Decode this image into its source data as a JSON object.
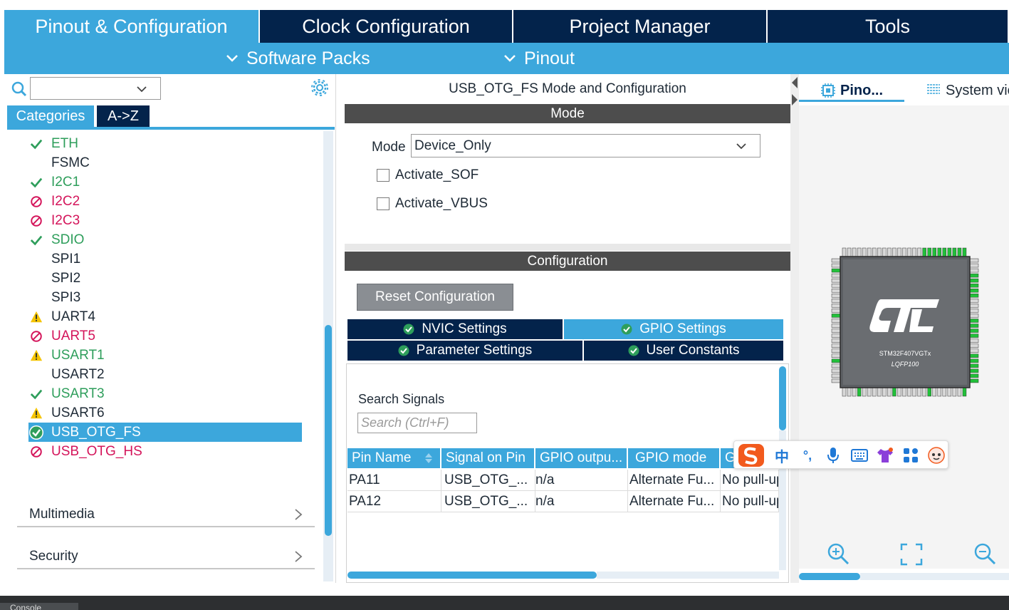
{
  "top_tabs": [
    {
      "label": "Pinout & Configuration",
      "active": true
    },
    {
      "label": "Clock Configuration",
      "active": false
    },
    {
      "label": "Project Manager",
      "active": false
    },
    {
      "label": "Tools",
      "active": false
    }
  ],
  "sub_menu": {
    "software_packs": "Software Packs",
    "pinout": "Pinout"
  },
  "left": {
    "search_value": "",
    "categories_tab": "Categories",
    "az_tab": "A->Z",
    "peripherals": [
      {
        "label": "ETH",
        "status": "ok"
      },
      {
        "label": "FSMC",
        "status": "none"
      },
      {
        "label": "I2C1",
        "status": "ok"
      },
      {
        "label": "I2C2",
        "status": "blocked"
      },
      {
        "label": "I2C3",
        "status": "blocked"
      },
      {
        "label": "SDIO",
        "status": "ok"
      },
      {
        "label": "SPI1",
        "status": "none"
      },
      {
        "label": "SPI2",
        "status": "none"
      },
      {
        "label": "SPI3",
        "status": "none"
      },
      {
        "label": "UART4",
        "status": "warn"
      },
      {
        "label": "UART5",
        "status": "blocked"
      },
      {
        "label": "USART1",
        "status": "warn"
      },
      {
        "label": "USART2",
        "status": "none"
      },
      {
        "label": "USART3",
        "status": "ok"
      },
      {
        "label": "USART6",
        "status": "warn"
      },
      {
        "label": "USB_OTG_FS",
        "status": "selected"
      },
      {
        "label": "USB_OTG_HS",
        "status": "blocked"
      }
    ],
    "groups": [
      "Multimedia",
      "Security"
    ]
  },
  "middle": {
    "title": "USB_OTG_FS Mode and Configuration",
    "mode_header": "Mode",
    "mode_label": "Mode",
    "mode_value": "Device_Only",
    "checkboxes": [
      "Activate_SOF",
      "Activate_VBUS"
    ],
    "config_header": "Configuration",
    "reset_button": "Reset Configuration",
    "tabs": {
      "nvic": "NVIC Settings",
      "gpio": "GPIO Settings",
      "parameter": "Parameter Settings",
      "user_constants": "User Constants"
    },
    "search_label": "Search Signals",
    "search_placeholder": "Search (Ctrl+F)",
    "table": {
      "headers": [
        "Pin Name",
        "Signal on Pin",
        "GPIO outpu...",
        "GPIO mode",
        "G"
      ],
      "rows": [
        [
          "PA11",
          "USB_OTG_...",
          "n/a",
          "Alternate Fu...",
          "No pull-up"
        ],
        [
          "PA12",
          "USB_OTG_...",
          "n/a",
          "Alternate Fu...",
          "No pull-up"
        ]
      ]
    }
  },
  "right": {
    "tab_pinout": "Pino...",
    "tab_system": "System view",
    "chip": {
      "name": "STM32F407VGTx",
      "package": "LQFP100"
    }
  },
  "ime": {
    "lang_label": "中",
    "punct_label": "°,"
  },
  "bottom": {
    "console_label": "Console"
  },
  "colors": {
    "accent": "#3ca7dc",
    "navy": "#03234b",
    "ok": "#2e9e5b",
    "blocked": "#d4145a",
    "warn": "#f5c400"
  }
}
